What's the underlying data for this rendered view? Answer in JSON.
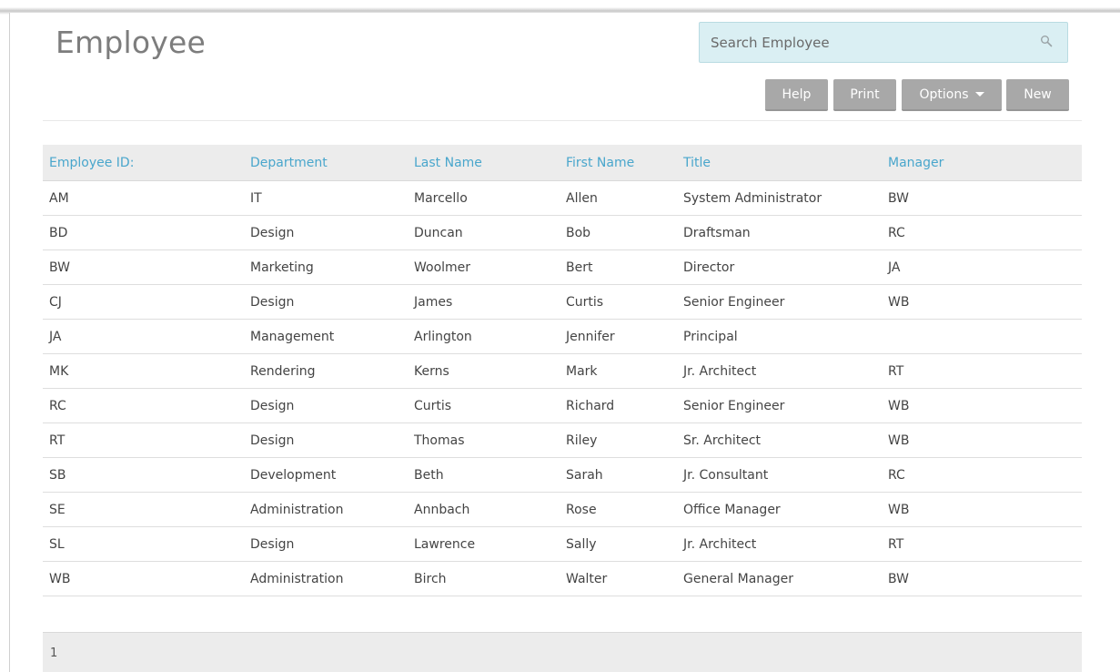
{
  "page": {
    "title": "Employee"
  },
  "search": {
    "placeholder": "Search Employee",
    "value": "",
    "icon": "search-icon"
  },
  "toolbar": {
    "help": "Help",
    "print": "Print",
    "options": "Options",
    "new": "New"
  },
  "table": {
    "columns": [
      "Employee ID:",
      "Department",
      "Last Name",
      "First Name",
      "Title",
      "Manager"
    ],
    "rows": [
      [
        "AM",
        "IT",
        "Marcello",
        "Allen",
        "System Administrator",
        "BW"
      ],
      [
        "BD",
        "Design",
        "Duncan",
        "Bob",
        "Draftsman",
        "RC"
      ],
      [
        "BW",
        "Marketing",
        "Woolmer",
        "Bert",
        "Director",
        "JA"
      ],
      [
        "CJ",
        "Design",
        "James",
        "Curtis",
        "Senior Engineer",
        "WB"
      ],
      [
        "JA",
        "Management",
        "Arlington",
        "Jennifer",
        "Principal",
        ""
      ],
      [
        "MK",
        "Rendering",
        "Kerns",
        "Mark",
        "Jr. Architect",
        "RT"
      ],
      [
        "RC",
        "Design",
        "Curtis",
        "Richard",
        "Senior Engineer",
        "WB"
      ],
      [
        "RT",
        "Design",
        "Thomas",
        "Riley",
        "Sr. Architect",
        "WB"
      ],
      [
        "SB",
        "Development",
        "Beth",
        "Sarah",
        "Jr. Consultant",
        "RC"
      ],
      [
        "SE",
        "Administration",
        "Annbach",
        "Rose",
        "Office Manager",
        "WB"
      ],
      [
        "SL",
        "Design",
        "Lawrence",
        "Sally",
        "Jr. Architect",
        "RT"
      ],
      [
        "WB",
        "Administration",
        "Birch",
        "Walter",
        "General Manager",
        "BW"
      ]
    ]
  },
  "pagination": {
    "current_page": "1"
  },
  "colors": {
    "header_text": "#49a6cc",
    "button_bg": "#a8a8a8",
    "search_bg": "#daeff3"
  }
}
